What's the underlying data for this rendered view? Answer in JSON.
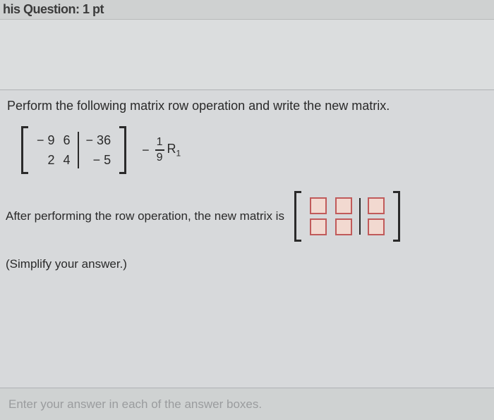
{
  "header": {
    "title_fragment": "his Question: 1 pt"
  },
  "question": {
    "prompt": "Perform the following matrix row operation and write the new matrix.",
    "matrix": {
      "rows": [
        {
          "a": "− 9",
          "b": "6",
          "aug": "− 36"
        },
        {
          "a": "2",
          "b": "4",
          "aug": "− 5"
        }
      ]
    },
    "operation": {
      "sign": "−",
      "numerator": "1",
      "denominator": "9",
      "row_label": "R",
      "row_index": "1"
    },
    "result_lead": "After performing the row operation, the new matrix is",
    "simplify_note": "(Simplify your answer.)"
  },
  "footer": {
    "hint": "Enter your answer in each of the answer boxes."
  }
}
